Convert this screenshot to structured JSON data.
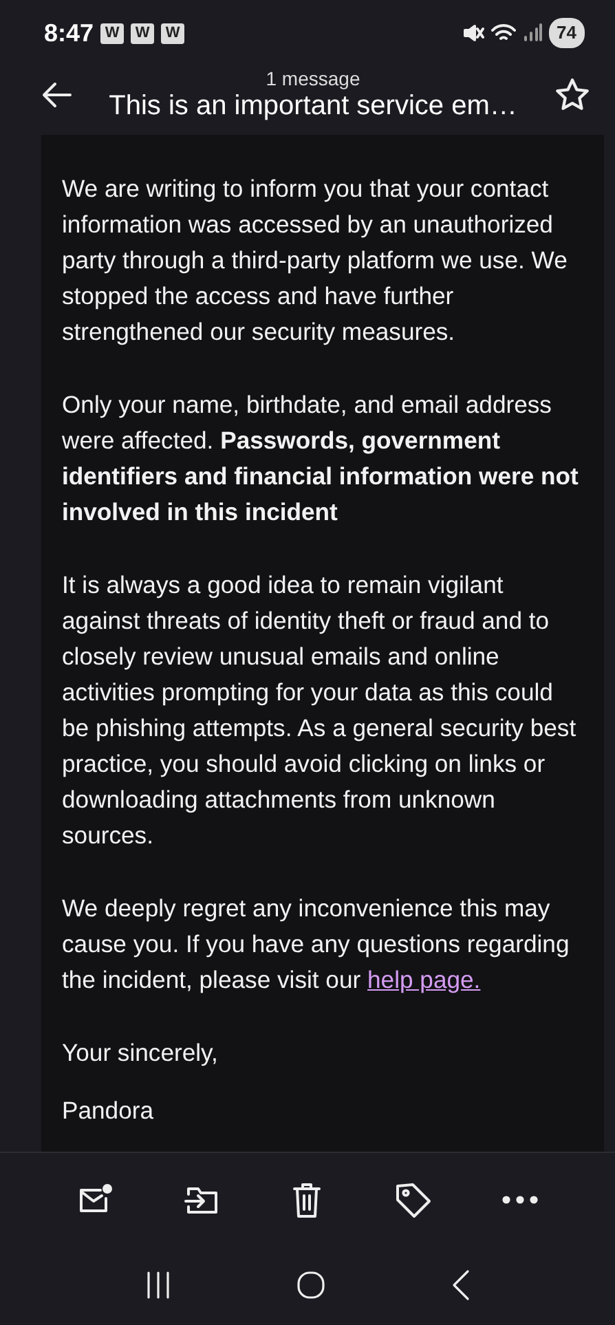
{
  "status_bar": {
    "time": "8:47",
    "notifications": [
      "W",
      "W",
      "W"
    ],
    "battery": "74"
  },
  "header": {
    "subtitle": "1 message",
    "title": "This is an important service em…",
    "starred": false
  },
  "body": {
    "paragraphs": [
      {
        "text": "We are writing to inform you that your contact information was accessed by an unauthorized party through a third-party platform we use. We stopped the access and have further strengthened our security measures."
      },
      {
        "text": "Only your name, birthdate, and email address were affected. **Passwords, government identifiers and financial information were not involved in this incident**"
      },
      {
        "text": "It is always a good idea to remain vigilant against threats of identity theft or fraud and to closely review unusual emails and online activities prompting for your data as this could be phishing attempts. As a general security best practice, you should avoid clicking on links or downloading attachments from unknown sources."
      },
      {
        "text": "We deeply regret any inconvenience this may cause you. If you have any questions regarding the incident, please visit our",
        "link": "help page."
      },
      {
        "text": "Your sincerely,"
      },
      {
        "text": "Pandora"
      }
    ]
  },
  "toolbar": [
    {
      "kind": "unread"
    },
    {
      "kind": "move"
    },
    {
      "kind": "delete"
    },
    {
      "kind": "label"
    },
    {
      "kind": "more"
    }
  ],
  "nav_bar": [
    {
      "kind": "recents"
    },
    {
      "kind": "home"
    },
    {
      "kind": "back"
    }
  ]
}
